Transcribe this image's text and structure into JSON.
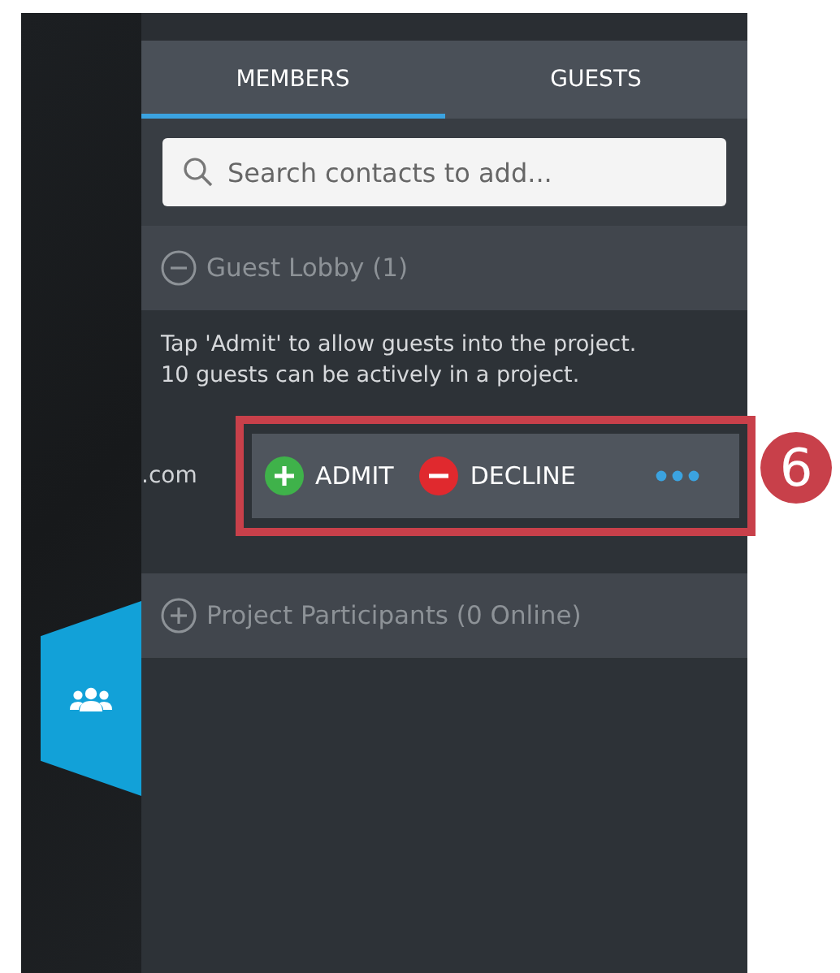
{
  "tabs": [
    {
      "label": "MEMBERS",
      "selected": true
    },
    {
      "label": "GUESTS",
      "selected": false
    }
  ],
  "search": {
    "placeholder": "Search contacts to add..."
  },
  "sections": [
    {
      "title": "Guest Lobby (1)",
      "expanded": true,
      "note": "Tap 'Admit' to allow guests into the project. 10 guests can be actively in a project.",
      "guests": [
        {
          "email": ".com",
          "actions": [
            {
              "kind": "admit",
              "label": "ADMIT"
            },
            {
              "kind": "decline",
              "label": "DECLINE"
            },
            {
              "kind": "more"
            }
          ]
        }
      ]
    },
    {
      "title": "Project Participants (0 Online)",
      "expanded": false
    }
  ],
  "callout": {
    "label": "6"
  }
}
